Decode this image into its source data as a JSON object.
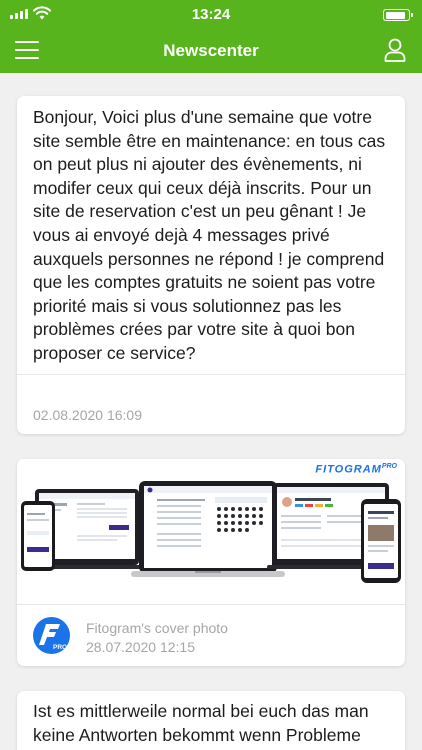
{
  "status_bar": {
    "time": "13:24",
    "battery_level": 0.95
  },
  "header": {
    "title": "Newscenter",
    "menu_icon": "hamburger-menu-icon",
    "profile_icon": "user-profile-icon"
  },
  "colors": {
    "brand_green": "#58b41d",
    "fitogram_blue": "#1a73e8",
    "date_gray": "#a6a6a6"
  },
  "feed": [
    {
      "text": "Bonjour, Voici plus d'une semaine que votre site semble être en maintenance: en tous cas on peut plus ni ajouter des évènements, ni modifer ceux qui ceux déjà inscrits. Pour un site de reservation c'est un peu gênant ! Je vous ai envoyé dejà 4 messages privé auxquels personnes ne répond ! je comprend que les comptes gratuits ne soient pas votre priorité mais si vous solutionnez pas les problèmes crées par votre site à quoi bon proposer ce service?",
      "date": "02.08.2020 16:09"
    },
    {
      "cover_brand": "FITOGRAM",
      "cover_brand_sup": "PRO",
      "author": "Fitogram's cover photo",
      "date": "28.07.2020 12:15",
      "avatar_label": "PRO"
    },
    {
      "text": "Ist es mittlerweile normal bei euch das man keine Antworten bekommt wenn Probleme"
    }
  ]
}
